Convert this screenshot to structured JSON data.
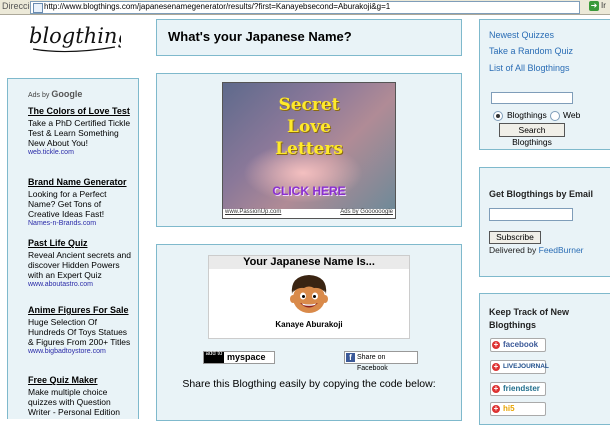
{
  "browser": {
    "address_label": "Dirección",
    "url": "http://www.blogthings.com/japanesenamegenerator/results/?first=Kanayebsecond=Aburakoji&g=1",
    "go_label": "Ir"
  },
  "logo": {
    "text": "blogthings"
  },
  "ads": {
    "ads_by": "Ads by",
    "ads_by_brand": "Google",
    "items": [
      {
        "title": "The Colors of Love Test",
        "desc": "Take a PhD Certified Tickle Test & Learn Something New About You!",
        "url": "web.tickle.com"
      },
      {
        "title": "Brand Name Generator",
        "desc": "Looking for a Perfect Name? Get Tons of Creative Ideas Fast!",
        "url": "Names-n-Brands.com"
      },
      {
        "title": "Past Life Quiz",
        "desc": "Reveal Ancient secrets and discover Hidden Powers with an Expert Quiz",
        "url": "www.aboutastro.com"
      },
      {
        "title": "Anime Figures For Sale",
        "desc": "Huge Selection Of Hundreds Of Toys Statues & Figures From 200+ Titles",
        "url": "www.bigbadtoystore.com"
      },
      {
        "title": "Free Quiz Maker",
        "desc": "Make multiple choice quizzes with Question Writer - Personal Edition",
        "url": ""
      }
    ]
  },
  "main": {
    "title": "What's your Japanese Name?",
    "banner": {
      "line1": "Secret",
      "line2": "Love",
      "line3": "Letters",
      "cta": "CLICK HERE",
      "footer_left": "www.PassionUp.com",
      "footer_right": "Ads by Goooooogle"
    },
    "result": {
      "header": "Your Japanese Name Is...",
      "name": "Kanaye Aburakoji"
    },
    "myspace": {
      "add_to": "add to",
      "label": "myspace"
    },
    "facebook_share": "Share on Facebook",
    "share_text": "Share this Blogthing easily by copying the code below:"
  },
  "sidebar": {
    "nav": [
      "Newest Quizzes",
      "Take a Random Quiz",
      "List of All Blogthings"
    ],
    "search": {
      "value": "",
      "radio_blogthings": "Blogthings",
      "radio_web": "Web",
      "button": "Search Blogthings"
    },
    "email": {
      "heading": "Get Blogthings by Email",
      "value": "",
      "button": "Subscribe",
      "delivered_by": "Delivered by",
      "delivered_brand": "FeedBurner"
    },
    "track": {
      "heading": "Keep Track of New Blogthings",
      "buttons": [
        "facebook",
        "LIVEJOURNAL",
        "friendster",
        "hi5"
      ]
    }
  },
  "colors": {
    "border": "#7fb9cc",
    "link": "#2a6db5",
    "banner_text": "#ffea2a",
    "cta": "#8a2fd0"
  }
}
